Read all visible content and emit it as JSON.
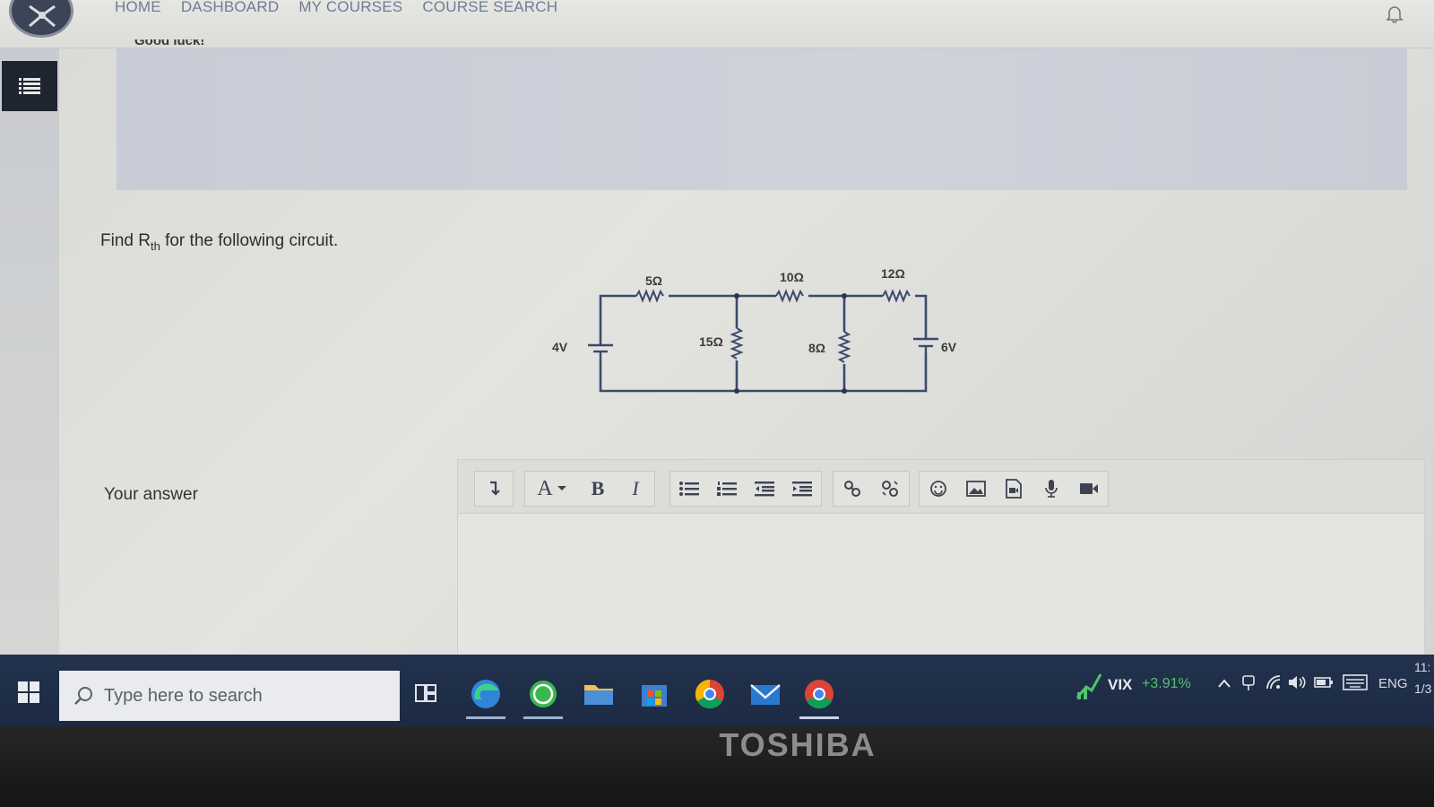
{
  "nav": {
    "items": [
      "HOME",
      "DASHBOARD",
      "MY COURSES",
      "COURSE SEARCH"
    ]
  },
  "banner": {
    "cut_text": "Good luck!"
  },
  "question": {
    "prefix": "Find R",
    "subscript": "th",
    "suffix": " for the following circuit."
  },
  "circuit": {
    "r1": "5Ω",
    "r2": "10Ω",
    "r3": "12Ω",
    "r4": "15Ω",
    "r5": "8Ω",
    "v1": "4V",
    "v2": "6V"
  },
  "answer": {
    "label": "Your answer"
  },
  "toolbar": {
    "font_label": "A",
    "bold_label": "B",
    "italic_label": "I"
  },
  "taskbar": {
    "search_placeholder": "Type here to search",
    "vix_name": "VIX",
    "vix_value": "+3.91%",
    "language": "ENG",
    "time": "11:",
    "date": "1/3"
  },
  "bezel": {
    "brand": "TOSHIBA"
  },
  "colors": {
    "nav_text": "#6e7d92",
    "taskbar": "#1c2a43",
    "vix_positive": "#4fc46b"
  }
}
